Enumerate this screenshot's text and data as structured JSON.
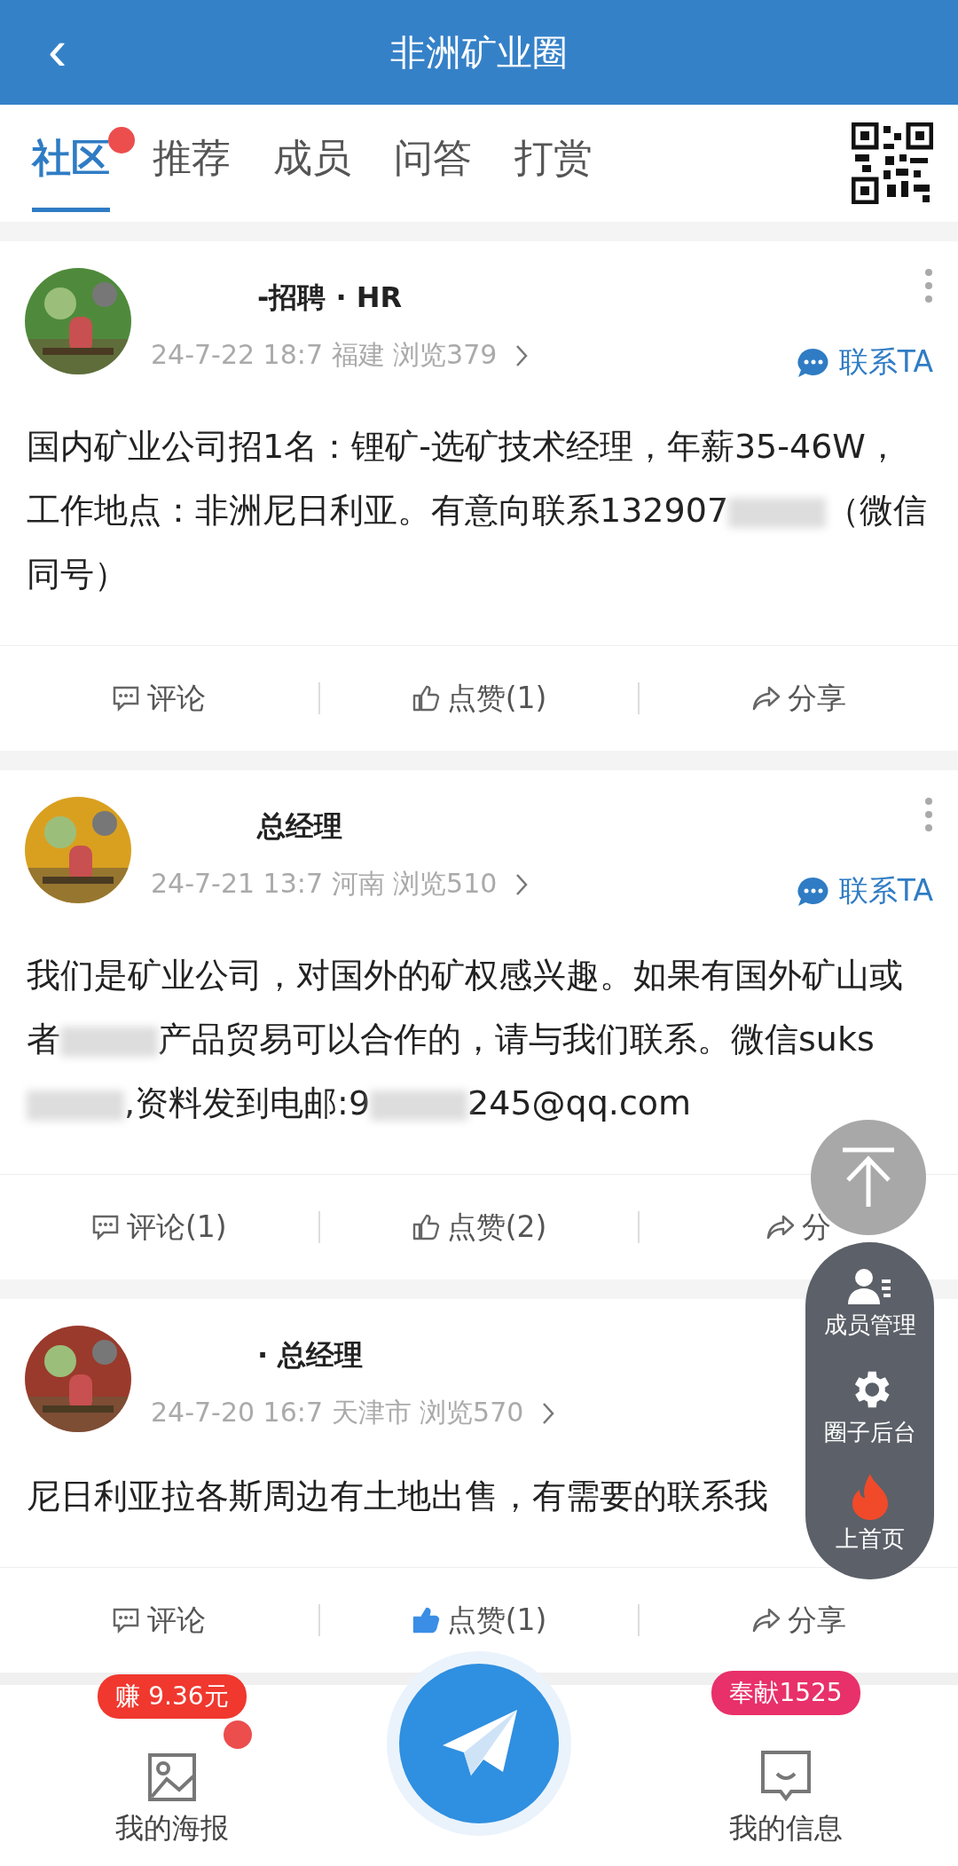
{
  "header": {
    "title": "非洲矿业圈",
    "back_icon": "‹"
  },
  "tabs": [
    {
      "label": "社区",
      "selected": true,
      "badge": true
    },
    {
      "label": "推荐",
      "selected": false,
      "badge": false
    },
    {
      "label": "成员",
      "selected": false,
      "badge": false
    },
    {
      "label": "问答",
      "selected": false,
      "badge": false
    },
    {
      "label": "打赏",
      "selected": false,
      "badge": false
    }
  ],
  "posts": [
    {
      "name": "-招聘 · HR",
      "meta": "24-7-22 18:7  福建  浏览379",
      "contact": "联系TA",
      "body": [
        "国内矿业公司招1名：锂矿-选矿技术经理，年薪35-46W，工作地点：非洲尼日利亚。有意向联系132907",
        "（微信同号）"
      ],
      "liked": false,
      "actions": [
        {
          "kind": "comment",
          "label": "评论"
        },
        {
          "kind": "like",
          "label": "点赞(1)"
        },
        {
          "kind": "share",
          "label": "分享"
        }
      ]
    },
    {
      "name": "总经理",
      "meta": "24-7-21 13:7  河南  浏览510",
      "contact": "联系TA",
      "body": [
        "我们是矿业公司，对国外的矿权感兴趣。如果有国外矿山或者",
        "产品贸易可以合作的，请与我们联系。微信suks",
        ",资料发到电邮:9",
        "245@qq.com"
      ],
      "liked": false,
      "actions": [
        {
          "kind": "comment",
          "label": "评论(1)"
        },
        {
          "kind": "like",
          "label": "点赞(2)"
        },
        {
          "kind": "share",
          "label": "分"
        }
      ]
    },
    {
      "name": "· 总经理",
      "meta": "24-7-20 16:7  天津市  浏览570",
      "body": [
        "尼日利亚拉各斯周边有土地出售，有需要的联系我"
      ],
      "liked": true,
      "actions": [
        {
          "kind": "comment",
          "label": "评论"
        },
        {
          "kind": "like",
          "label": "点赞(1)"
        },
        {
          "kind": "share",
          "label": "分享"
        }
      ]
    }
  ],
  "side_menu": [
    {
      "kind": "members",
      "label": "成员管理"
    },
    {
      "kind": "settings",
      "label": "圈子后台"
    },
    {
      "kind": "fire",
      "label": "上首页"
    }
  ],
  "bottom_bar": {
    "left": {
      "label": "我的海报",
      "badge": "赚 9.36元",
      "dot": true
    },
    "right": {
      "label": "我的信息",
      "badge": "奉献1525"
    }
  }
}
